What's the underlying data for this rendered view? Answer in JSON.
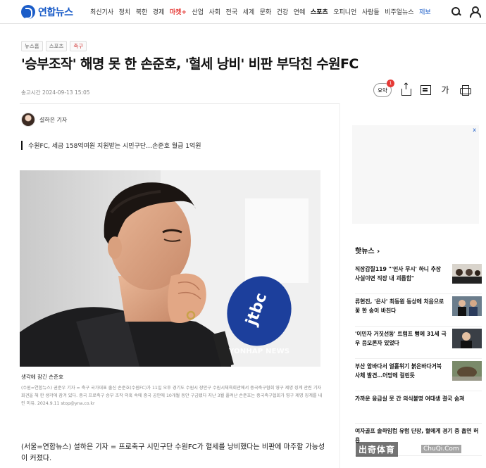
{
  "header": {
    "logo_text": "연합뉴스",
    "nav": [
      "최신기사",
      "정치",
      "북한",
      "경제",
      "마켓+",
      "산업",
      "사회",
      "전국",
      "세계",
      "문화",
      "건강",
      "연예",
      "스포츠",
      "오피니언",
      "사람들",
      "비주얼뉴스",
      "제보"
    ]
  },
  "breadcrumb": [
    "뉴스홈",
    "스포츠",
    "축구"
  ],
  "article": {
    "headline": "'승부조작' 해명 못 한 손준호, '혈세 낭비' 비판 부닥친 수원FC",
    "dateline": "송고시간  2024-09-13 15:05",
    "summary_label": "요약",
    "summary_badge": "1",
    "reporter": "설하은 기자",
    "subhead": "수원FC, 세금 158억여원 지원받는 시민구단…손준호 월급 1억원",
    "photo_watermark": "YONHAP NEWS",
    "photo_caption": "생각에 잠긴 손준호",
    "caption_body": "(수원=연합뉴스) 권준우 기자 = 축구 국가대표 출신 손준호(수원FC)가 11일 오후 경기도 수원시 장안구 수원시체육회관에서 중국축구협회 영구 제명 징계 관련 기자회견을 해 한 생각에 잠겨 있다. 중국 프로축구 승부 조작 의혹 속에 중국 공안에 10개월 동안 구금됐다 지난 3월 풀려난 손준호는 중국축구협회가 영구 제명 징계를 내린 이유. 2024.9.11 stop@yna.co.kr",
    "body": "(서울=연합뉴스) 설하은 기자 = 프로축구 시민구단 수원FC가 혈세를 낭비했다는 비판에 마주할 가능성이 커졌다."
  },
  "sidebar": {
    "ad_close": "x",
    "hot_title": "핫뉴스",
    "hot_items": [
      "직장갑질119 \"'인사 무시' 하니 추장 사실이면 직장 내 괴롭힘\"",
      "류현진, '은사' 최동원 동상에 처음으로 꽃 한 송이 바친다",
      "'이민자 거짓선동' 트럼프 뻥에 31세 극우 음모론자 있었다",
      "부산 앞바다서 열흘위기 붉은바다거북 사체 발견…어망에 걸린듯",
      "가까운 응급실 못 간 의식불명 여대생 결국 숨져",
      "여자골프 솔하임컵 유럽 단장, 혈에게 경기 중 흡연 허용"
    ],
    "promo_text": "出奇体育",
    "promo_url": "ChuQi.Com"
  },
  "colors": {
    "brand": "#1a5cc8",
    "accent": "#e53935"
  }
}
